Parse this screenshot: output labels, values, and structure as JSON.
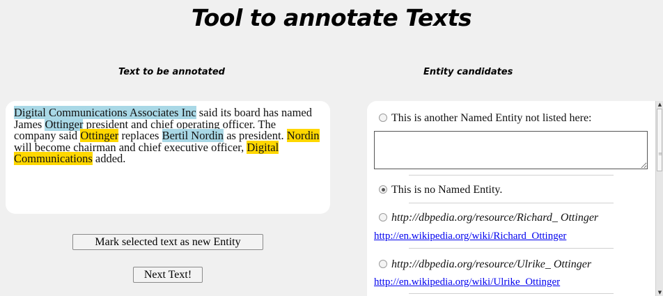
{
  "page": {
    "title": "Tool to annotate Texts"
  },
  "left": {
    "heading": "Text to be annotated",
    "segments": [
      {
        "text": "Digital Communications Associates Inc",
        "type": "entity"
      },
      {
        "text": " said its board has named James ",
        "type": "plain"
      },
      {
        "text": "Ottinger",
        "type": "entity"
      },
      {
        "text": " president and chief operating officer. The company said ",
        "type": "plain"
      },
      {
        "text": "Ottinger",
        "type": "selected"
      },
      {
        "text": " replaces ",
        "type": "plain"
      },
      {
        "text": "Bertil Nordin",
        "type": "entity"
      },
      {
        "text": " as president. ",
        "type": "plain"
      },
      {
        "text": "Nordin",
        "type": "selected"
      },
      {
        "text": " will become chairman and chief executive officer, ",
        "type": "plain"
      },
      {
        "text": "Digital Communications",
        "type": "selected"
      },
      {
        "text": " added.",
        "type": "plain"
      }
    ],
    "mark_button": "Mark selected text as new Entity",
    "next_button": "Next Text!"
  },
  "right": {
    "heading": "Entity candidates",
    "option_other": "This is another Named Entity not listed here:",
    "other_value": "",
    "option_none": "This is no Named Entity.",
    "selected_option": "none",
    "candidates": [
      {
        "uri": "http://dbpedia.org/resource/Richard_ Ottinger",
        "wiki": "http://en.wikipedia.org/wiki/Richard_Ottinger"
      },
      {
        "uri": "http://dbpedia.org/resource/Ulrike_ Ottinger",
        "wiki": "http://en.wikipedia.org/wiki/Ulrike_Ottinger"
      }
    ]
  },
  "colors": {
    "entity_highlight": "#a9d8e6",
    "selected_highlight": "#ffd700",
    "background": "#f0f0f0"
  }
}
